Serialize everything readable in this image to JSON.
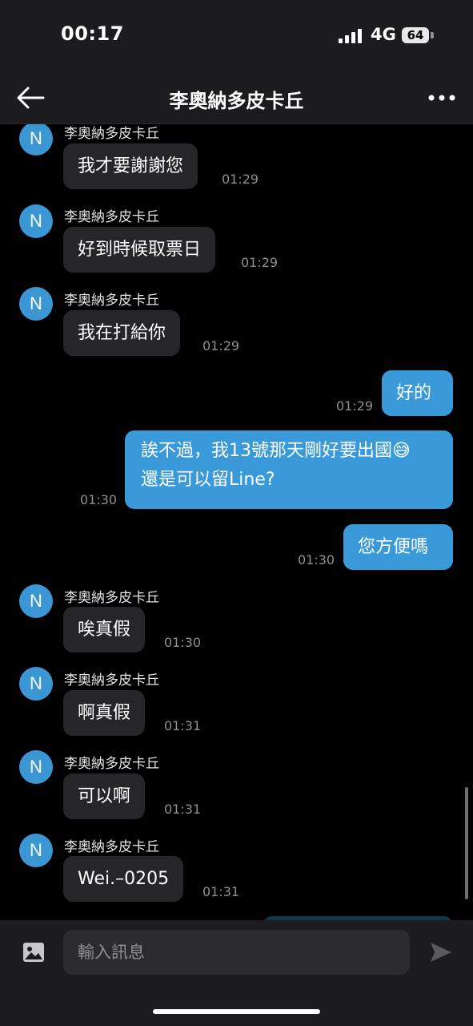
{
  "status": {
    "time": "00:17",
    "network": "4G",
    "battery": "64"
  },
  "header": {
    "title": "李奧納多皮卡丘"
  },
  "contact": {
    "avatar_letter": "N",
    "name": "李奧納多皮卡丘"
  },
  "messages": [
    {
      "from": "them",
      "sender": "李奧納多皮卡丘",
      "text": "我才要謝謝您",
      "time": "01:29"
    },
    {
      "from": "them",
      "sender": "李奧納多皮卡丘",
      "text": "好到時候取票日",
      "time": "01:29"
    },
    {
      "from": "them",
      "sender": "李奧納多皮卡丘",
      "text": "我在打給你",
      "time": "01:29"
    },
    {
      "from": "me",
      "text": "好的",
      "time": "01:29"
    },
    {
      "from": "me",
      "text_line1": "誒不過，我13號那天剛好要出國😅",
      "text_line2": "還是可以留Line?",
      "time": "01:30"
    },
    {
      "from": "me",
      "text": "您方便嗎",
      "time": "01:30"
    },
    {
      "from": "them",
      "sender": "李奧納多皮卡丘",
      "text": "唉真假",
      "time": "01:30"
    },
    {
      "from": "them",
      "sender": "李奧納多皮卡丘",
      "text": "啊真假",
      "time": "01:31"
    },
    {
      "from": "them",
      "sender": "李奧納多皮卡丘",
      "text": "可以啊",
      "time": "01:31"
    },
    {
      "from": "them",
      "sender": "李奧納多皮卡丘",
      "text": "Wei.–0205",
      "time": "01:31"
    }
  ],
  "composer": {
    "placeholder": "輸入訊息"
  },
  "icons": {
    "back": "back-arrow-icon",
    "more": "more-dots-icon",
    "image": "image-icon",
    "send": "send-icon"
  },
  "colors": {
    "accent": "#3a9ad9",
    "incoming_bubble": "#262628",
    "avatar": "#3a97d4"
  }
}
